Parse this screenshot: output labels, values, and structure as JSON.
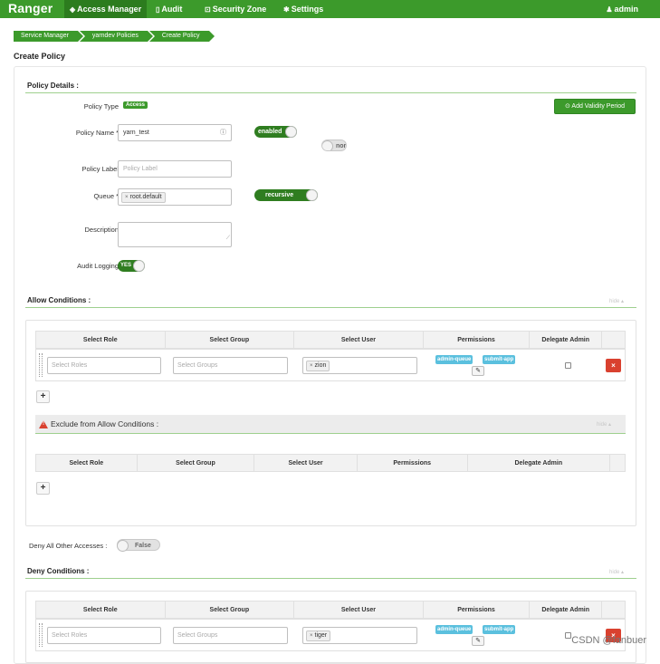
{
  "nav": {
    "brand": "Ranger",
    "items": [
      {
        "label": "Access Manager",
        "icon": "shield-icon"
      },
      {
        "label": "Audit",
        "icon": "file-icon"
      },
      {
        "label": "Security Zone",
        "icon": "zone-icon"
      },
      {
        "label": "Settings",
        "icon": "gear-icon"
      }
    ],
    "user": "admin"
  },
  "breadcrumb": [
    "Service Manager",
    "yarndev Policies",
    "Create Policy"
  ],
  "page_title": "Create Policy",
  "policy_details": {
    "section_title": "Policy Details :",
    "policy_type_label": "Policy Type",
    "policy_type_value": "Access",
    "add_validity_label": "Add Validity Period",
    "policy_name_label": "Policy Name *",
    "policy_name_value": "yarn_test",
    "enabled_toggle": "enabled",
    "normal_toggle": "nor",
    "policy_label_label": "Policy Label",
    "policy_label_placeholder": "Policy Label",
    "queue_label": "Queue *",
    "queue_tag": "root.default",
    "recursive_toggle": "recursive",
    "description_label": "Description",
    "audit_label": "Audit Logging",
    "audit_toggle": "YES"
  },
  "allow": {
    "section_title": "Allow Conditions :",
    "hide": "hide",
    "columns": [
      "Select Role",
      "Select Group",
      "Select User",
      "Permissions",
      "Delegate Admin"
    ],
    "role_placeholder": "Select Roles",
    "group_placeholder": "Select Groups",
    "user_tag": "zion",
    "permissions": [
      "admin-queue",
      "submit-app"
    ],
    "delete": "×",
    "add": "+"
  },
  "exclude_allow": {
    "title": "Exclude from Allow Conditions :",
    "hide": "hide",
    "columns": [
      "Select Role",
      "Select Group",
      "Select User",
      "Permissions",
      "Delegate Admin"
    ],
    "add": "+"
  },
  "deny_all": {
    "label": "Deny All Other Accesses :",
    "toggle": "False"
  },
  "deny": {
    "section_title": "Deny Conditions :",
    "hide": "hide",
    "columns": [
      "Select Role",
      "Select Group",
      "Select User",
      "Permissions",
      "Delegate Admin"
    ],
    "role_placeholder": "Select Roles",
    "group_placeholder": "Select Groups",
    "user_tag": "tiger",
    "permissions": [
      "admin-queue",
      "submit-app"
    ],
    "delete": "×"
  },
  "watermark": "CSDN @fanbuer",
  "colors": {
    "brand_green": "#3c9a2b",
    "perm_blue": "#5bc0de",
    "danger_red": "#d9412f"
  }
}
